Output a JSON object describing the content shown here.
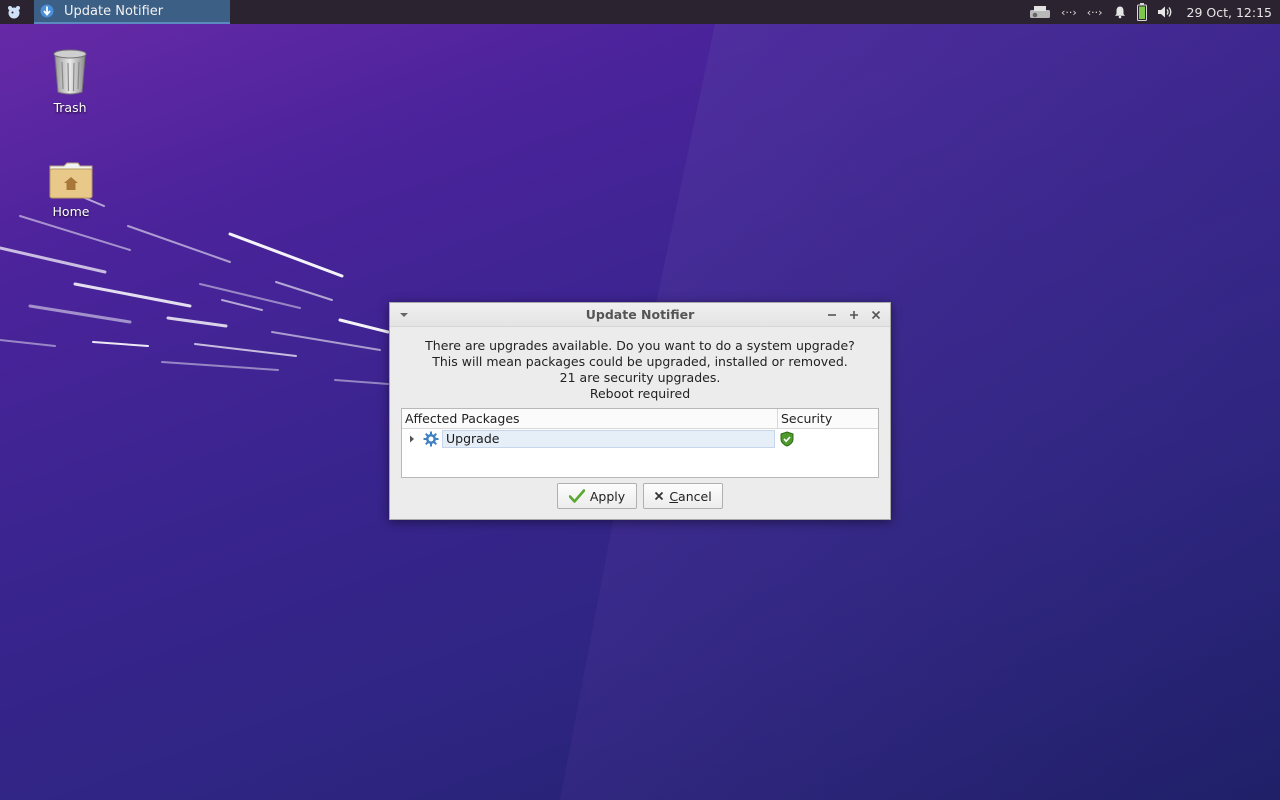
{
  "panel": {
    "task_title": "Update Notifier",
    "clock": "29 Oct, 12:15",
    "tray_icons": [
      "printer-icon",
      "network-icon",
      "network-icon",
      "notification-bell-icon",
      "battery-icon",
      "volume-icon"
    ],
    "net_glyph": "‹··›"
  },
  "desktop": {
    "icons": [
      {
        "label": "Trash",
        "icon": "trash-icon"
      },
      {
        "label": "Home",
        "icon": "home-folder-icon"
      }
    ]
  },
  "dialog": {
    "title": "Update Notifier",
    "message_lines": [
      "There are upgrades available. Do you want to do a system upgrade?",
      "This will mean packages could be upgraded, installed or removed.",
      "21 are security upgrades.",
      "Reboot required"
    ],
    "table": {
      "col_packages": "Affected Packages",
      "col_security": "Security",
      "rows": [
        {
          "label": "Upgrade",
          "icon": "gear-icon",
          "security_icon": "shield-check-icon"
        }
      ]
    },
    "apply_label": "Apply",
    "cancel_prefix": "",
    "cancel_mnemonic": "C",
    "cancel_rest": "ancel"
  },
  "colors": {
    "panel_bg": "#2b2430",
    "task_active": "#3c5f86",
    "dialog_bg": "#ececec",
    "accent_green": "#5aa832"
  }
}
